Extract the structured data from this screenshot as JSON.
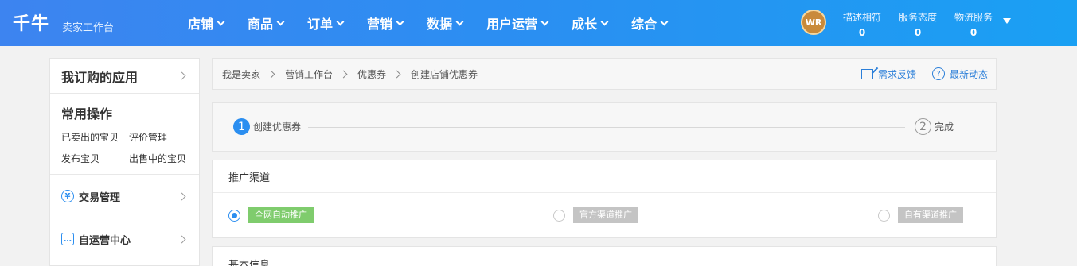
{
  "header": {
    "logo": "千牛",
    "subtitle": "卖家工作台",
    "nav": [
      "店铺",
      "商品",
      "订单",
      "营销",
      "数据",
      "用户运营",
      "成长",
      "综合"
    ],
    "avatar_text": "WR",
    "scores": [
      {
        "label": "描述相符",
        "value": "0"
      },
      {
        "label": "服务态度",
        "value": "0"
      },
      {
        "label": "物流服务",
        "value": "0"
      }
    ]
  },
  "sidebar": {
    "title": "我订购的应用",
    "common_title": "常用操作",
    "common_links": [
      "已卖出的宝贝",
      "评价管理",
      "发布宝贝",
      "出售中的宝贝"
    ],
    "menus": [
      {
        "icon": "yen-icon",
        "label": "交易管理"
      },
      {
        "icon": "chat-icon",
        "label": "自运营中心"
      }
    ]
  },
  "breadcrumb": {
    "items": [
      "我是卖家",
      "营销工作台",
      "优惠券",
      "创建店铺优惠券"
    ],
    "links": [
      {
        "icon": "edit-icon",
        "label": "需求反馈"
      },
      {
        "icon": "help-icon",
        "label": "最新动态"
      }
    ]
  },
  "steps": [
    {
      "num": "1",
      "label": "创建优惠券",
      "active": true
    },
    {
      "num": "2",
      "label": "完成",
      "active": false
    }
  ],
  "channel": {
    "title": "推广渠道",
    "options": [
      {
        "label": "全网自动推广",
        "selected": true
      },
      {
        "label": "官方渠道推广",
        "selected": false
      },
      {
        "label": "自有渠道推广",
        "selected": false
      }
    ]
  },
  "basic_info": {
    "title": "基本信息"
  },
  "colors": {
    "topbar": "#2a8ff2",
    "accent": "#2b8ef0",
    "tag_green": "#7fcc6d",
    "tag_gray": "#c4c4c4"
  }
}
